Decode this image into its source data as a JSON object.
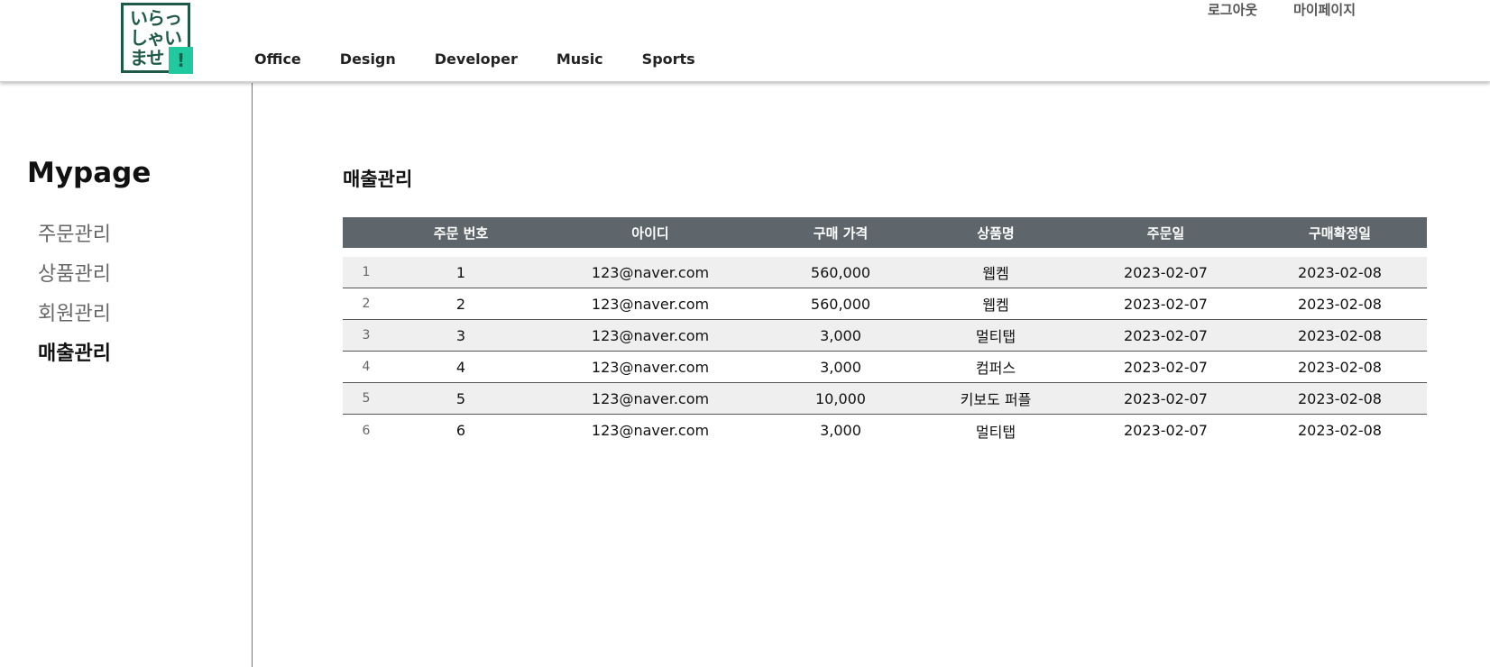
{
  "header": {
    "logo": {
      "line1": "いらっ",
      "line2": "しゃい",
      "line3": "ませ",
      "mark": "!"
    },
    "nav": [
      "Office",
      "Design",
      "Developer",
      "Music",
      "Sports"
    ],
    "util": {
      "logout": "로그아웃",
      "mypage": "마이페이지"
    }
  },
  "sidebar": {
    "title": "Mypage",
    "items": [
      {
        "label": "주문관리"
      },
      {
        "label": "상품관리"
      },
      {
        "label": "회원관리"
      },
      {
        "label": "매출관리"
      }
    ]
  },
  "main": {
    "title": "매출관리",
    "columns": [
      "",
      "주문 번호",
      "아이디",
      "구매 가격",
      "상품명",
      "주문일",
      "구매확정일"
    ],
    "rows": [
      [
        "1",
        "1",
        "123@naver.com",
        "560,000",
        "웹켐",
        "2023-02-07",
        "2023-02-08"
      ],
      [
        "2",
        "2",
        "123@naver.com",
        "560,000",
        "웹켐",
        "2023-02-07",
        "2023-02-08"
      ],
      [
        "3",
        "3",
        "123@naver.com",
        "3,000",
        "멀티탭",
        "2023-02-07",
        "2023-02-08"
      ],
      [
        "4",
        "4",
        "123@naver.com",
        "3,000",
        "컴퍼스",
        "2023-02-07",
        "2023-02-08"
      ],
      [
        "5",
        "5",
        "123@naver.com",
        "10,000",
        "키보도 퍼플",
        "2023-02-07",
        "2023-02-08"
      ],
      [
        "6",
        "6",
        "123@naver.com",
        "3,000",
        "멀티탭",
        "2023-02-07",
        "2023-02-08"
      ]
    ]
  },
  "colors": {
    "header_row": "#5f666b",
    "logo_green": "#1f5a48",
    "logo_accent": "#20c9a0",
    "alt_row": "#efefef"
  }
}
